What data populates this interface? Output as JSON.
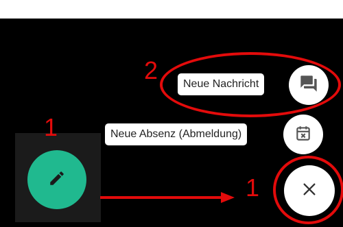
{
  "menu": {
    "new_message_label": "Neue Nachricht",
    "new_absence_label": "Neue Absenz (Abmeldung)"
  },
  "annotations": {
    "number_left": "1",
    "number_message": "2",
    "number_close": "1"
  },
  "icons": {
    "edit": "pencil-icon",
    "message": "chat-icon",
    "absence": "calendar-x-icon",
    "close": "close-icon"
  },
  "colors": {
    "background": "#000000",
    "fab_green": "#20b98f",
    "annotation_red": "#e30b0b",
    "icon_gray": "#555555"
  }
}
